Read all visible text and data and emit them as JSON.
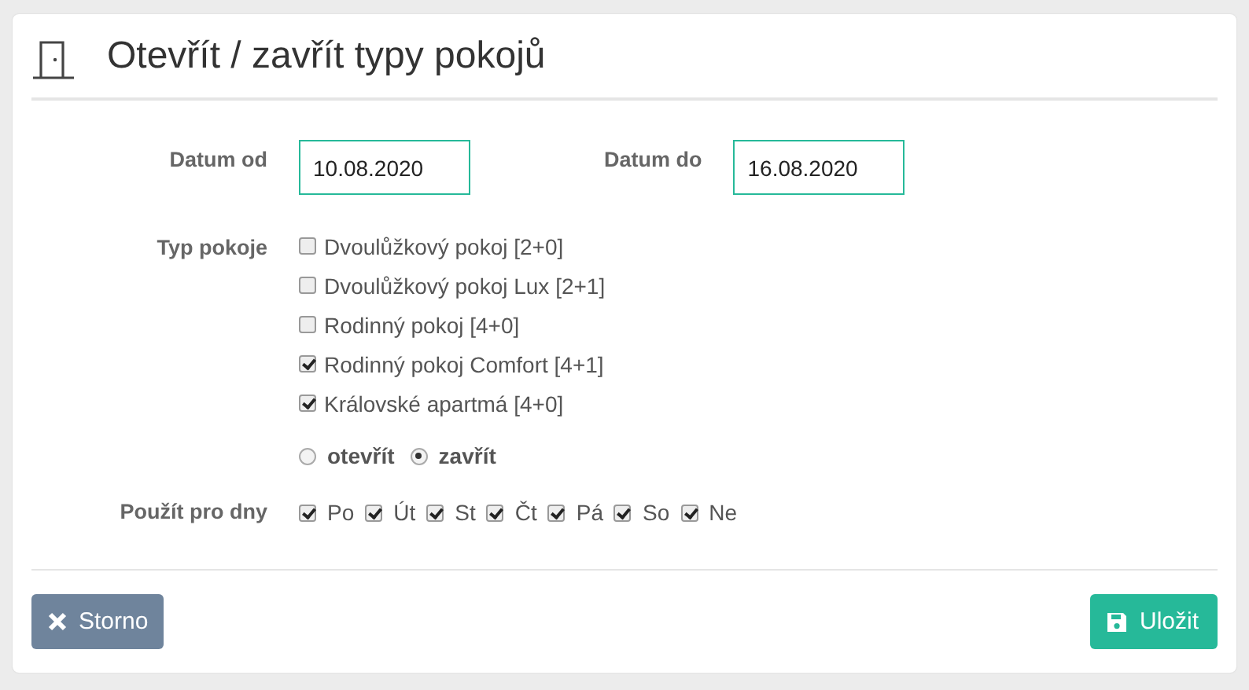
{
  "title": "Otevřít / zavřít typy pokojů",
  "date_from": {
    "label": "Datum od",
    "value": "10.08.2020"
  },
  "date_to": {
    "label": "Datum do",
    "value": "16.08.2020"
  },
  "room_types": {
    "label": "Typ pokoje",
    "items": [
      {
        "label": "Dvoulůžkový pokoj [2+0]",
        "checked": false
      },
      {
        "label": "Dvoulůžkový pokoj Lux [2+1]",
        "checked": false
      },
      {
        "label": "Rodinný pokoj [4+0]",
        "checked": false
      },
      {
        "label": "Rodinný pokoj Comfort [4+1]",
        "checked": true
      },
      {
        "label": "Královské apartmá [4+0]",
        "checked": true
      }
    ]
  },
  "action": [
    {
      "label": "otevřít",
      "selected": false
    },
    {
      "label": "zavřít",
      "selected": true
    }
  ],
  "days": {
    "label": "Použít pro dny",
    "items": [
      {
        "label": "Po",
        "checked": true
      },
      {
        "label": "Út",
        "checked": true
      },
      {
        "label": "St",
        "checked": true
      },
      {
        "label": "Čt",
        "checked": true
      },
      {
        "label": "Pá",
        "checked": true
      },
      {
        "label": "So",
        "checked": true
      },
      {
        "label": "Ne",
        "checked": true
      }
    ]
  },
  "buttons": {
    "cancel": "Storno",
    "save": "Uložit"
  }
}
